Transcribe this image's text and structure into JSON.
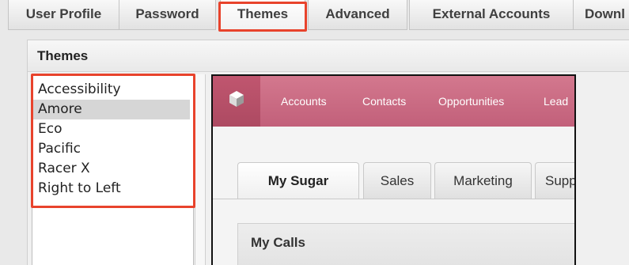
{
  "tabs": [
    {
      "label": "User Profile"
    },
    {
      "label": "Password"
    },
    {
      "label": "Themes"
    },
    {
      "label": "Advanced"
    },
    {
      "label": "External Accounts"
    },
    {
      "label": "Downl"
    }
  ],
  "panel": {
    "title": "Themes"
  },
  "themes": {
    "items": [
      "Accessibility",
      "Amore",
      "Eco",
      "Pacific",
      "Racer X",
      "Right to Left"
    ],
    "selected": "Amore"
  },
  "preview": {
    "nav": [
      "Accounts",
      "Contacts",
      "Opportunities",
      "Lead"
    ],
    "tabs": [
      "My Sugar",
      "Sales",
      "Marketing",
      "Supp"
    ],
    "dashlet_title": "My Calls",
    "colors": {
      "nav": "#c96a83",
      "logo": "#b14f67",
      "highlight": "#e8432c"
    }
  }
}
